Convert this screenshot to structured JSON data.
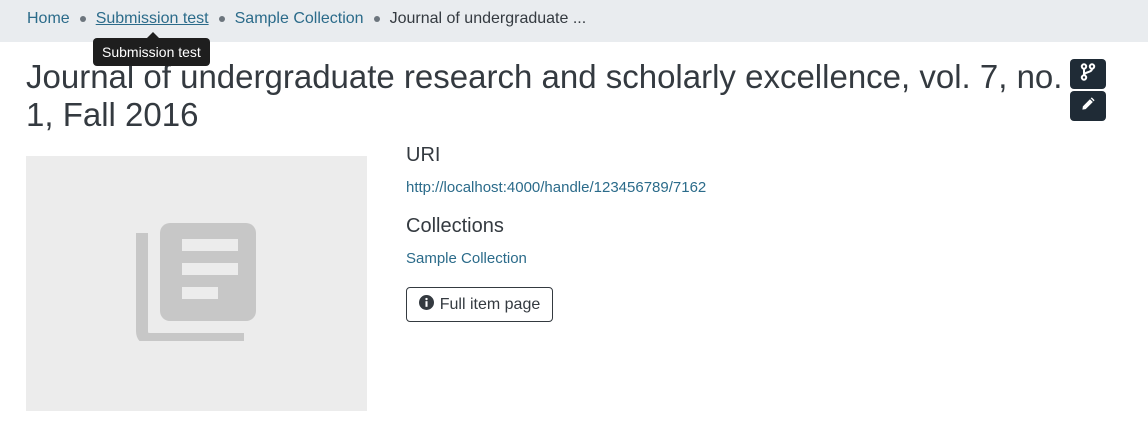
{
  "breadcrumb": {
    "items": [
      {
        "label": "Home"
      },
      {
        "label": "Submission test"
      },
      {
        "label": "Sample Collection"
      },
      {
        "label": "Journal of undergraduate ..."
      }
    ]
  },
  "tooltip": {
    "text": "Submission test"
  },
  "item": {
    "title": "Journal of undergraduate research and scholarly excellence, vol. 7, no. 1, Fall 2016"
  },
  "actions": {
    "top_icon": "branch-icon",
    "bottom_icon": "pencil-icon"
  },
  "thumbnail": {
    "icon": "collection-icon"
  },
  "uri": {
    "label": "URI",
    "value": "http://localhost:4000/handle/123456789/7162"
  },
  "collections": {
    "label": "Collections",
    "value": "Sample Collection"
  },
  "full_item": {
    "label": "Full item page",
    "icon": "info-icon"
  },
  "colors": {
    "link": "#2b6b8a",
    "dark_button": "#1f2b36",
    "breadcrumb_bg": "#e9ecef"
  }
}
